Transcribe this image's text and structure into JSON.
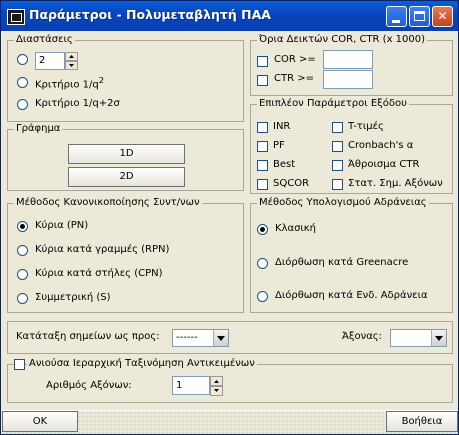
{
  "window": {
    "title": "Παράμετροι - Πολυμεταβλητή ΠΑΑ"
  },
  "dimensions": {
    "legend": "Διαστάσεις",
    "spin_value": "2",
    "criterion1": "Κριτήριο 1/q",
    "criterion1_sup": "2",
    "criterion2": "Κριτήριο 1/q+2σ"
  },
  "limits": {
    "legend": "Όρια Δεικτών COR, CTR (x 1000)",
    "cor_label": "COR >=",
    "ctr_label": "CTR >="
  },
  "graphs": {
    "legend": "Γράφημα",
    "btn_1d": "1D",
    "btn_2d": "2D"
  },
  "extra": {
    "legend": "Επιπλέον Παράμετροι Εξόδου",
    "items": [
      "INR",
      "T-τιμές",
      "PF",
      "Cronbach's α",
      "Best",
      "Άθροισμα CTR",
      "SQCOR",
      "Στατ. Σημ. Αξόνων"
    ]
  },
  "normalization": {
    "legend": "Μέθοδος Κανονικοποίησης Συντ/νων",
    "options": [
      "Κύρια (PN)",
      "Κύρια κατά γραμμές (RPN)",
      "Κύρια κατά στήλες (CPN)",
      "Συμμετρική (S)"
    ],
    "selected": 0
  },
  "inertia": {
    "legend": "Μέθοδος Υπολογισμού Αδράνειας",
    "options": [
      "Κλασική",
      "Διόρθωση κατά Greenacre",
      "Διόρθωση κατά Ενδ. Αδράνεια"
    ],
    "selected": 0
  },
  "sort": {
    "label": "Κατάταξη σημείων ως προς:",
    "value": "------",
    "axis_label": "Άξονας:",
    "axis_value": ""
  },
  "hierarchy": {
    "label": "Ανιούσα Ιεραρχική Ταξινόμηση Αντικειμένων",
    "axes_label": "Αριθμός Αξόνων:",
    "axes_value": "1"
  },
  "footer": {
    "ok": "OK",
    "help": "Βοήθεια"
  }
}
